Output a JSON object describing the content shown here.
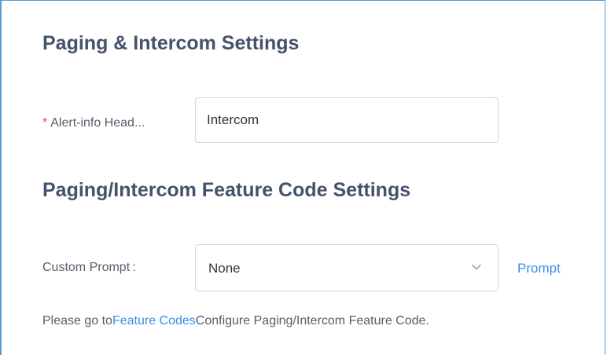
{
  "paging_section": {
    "title": "Paging & Intercom Settings",
    "alert_info": {
      "required_marker": "*",
      "label": "Alert-info Head...",
      "value": "Intercom"
    }
  },
  "feature_code_section": {
    "title": "Paging/Intercom Feature Code Settings",
    "custom_prompt": {
      "label": "Custom Prompt :",
      "selected": "None",
      "link": "Prompt"
    },
    "note": {
      "prefix": "Please go to",
      "link": "Feature Codes",
      "suffix": "Configure Paging/Intercom Feature Code."
    }
  },
  "colors": {
    "accent": "#3a8ee6",
    "required": "#e84a3d",
    "panel_border": "#5b9bd5",
    "title": "#45526b"
  },
  "icons": {
    "select_arrow": "chevron-down-icon"
  }
}
